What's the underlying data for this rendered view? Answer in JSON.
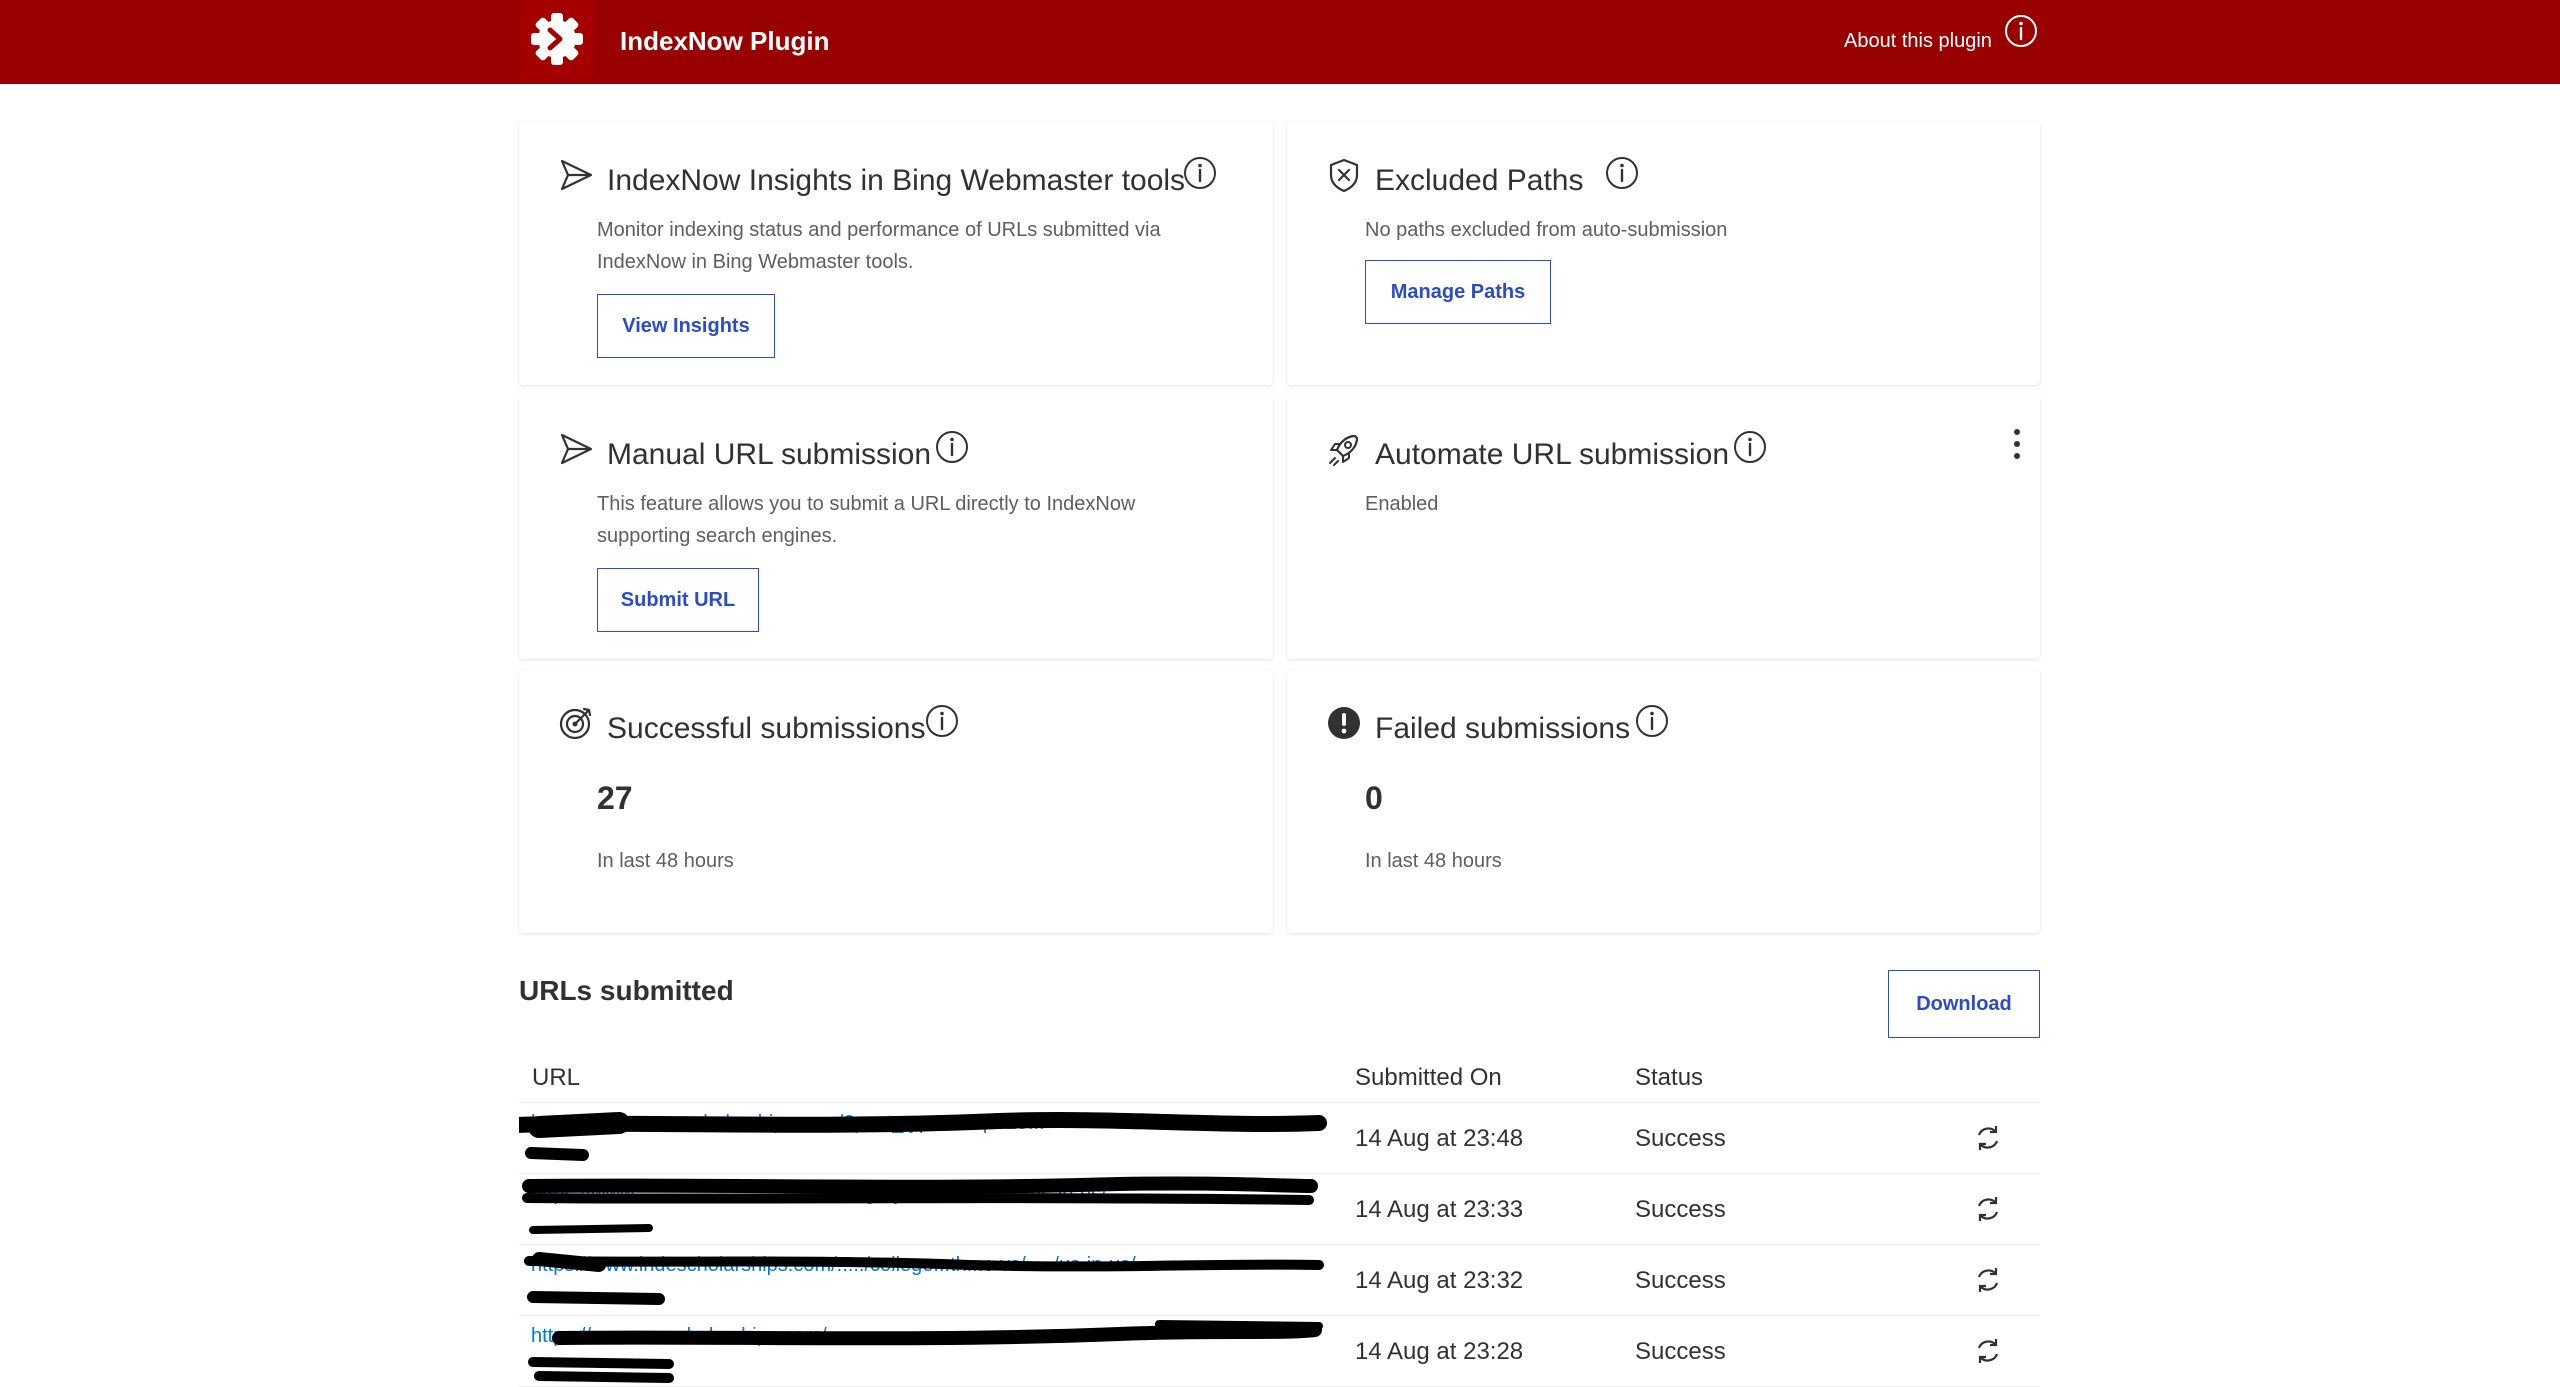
{
  "app": {
    "title": "IndexNow Plugin",
    "about_label": "About this plugin",
    "brand_color": "#990000"
  },
  "cards": {
    "insights": {
      "title": "IndexNow Insights in Bing Webmaster tools",
      "desc_line1": "Monitor indexing status and performance of URLs submitted via",
      "desc_line2": "IndexNow in Bing Webmaster tools.",
      "button": "View Insights"
    },
    "excluded": {
      "title": "Excluded Paths",
      "desc": "No paths excluded from auto-submission",
      "button": "Manage Paths"
    },
    "manual": {
      "title": "Manual URL submission",
      "desc_line1": "This feature allows you to submit a URL directly to IndexNow",
      "desc_line2": "supporting search engines.",
      "button": "Submit URL"
    },
    "automate": {
      "title": "Automate URL submission",
      "status": "Enabled"
    },
    "successful": {
      "title": "Successful submissions",
      "count": "27",
      "period": "In last 48 hours"
    },
    "failed": {
      "title": "Failed submissions",
      "count": "0",
      "period": "In last 48 hours"
    }
  },
  "urls_section": {
    "title": "URLs submitted",
    "download_label": "Download",
    "columns": {
      "url": "URL",
      "submitted_on": "Submitted On",
      "status": "Status"
    },
    "rows": [
      {
        "url": "https://www.........scholarships.com/?post_type=...&p=25...",
        "submitted_on": "14 Aug at 23:48",
        "status": "Success"
      },
      {
        "url": "https://www...........................com/category/........./.../ce.../us-in-us/",
        "submitted_on": "14 Aug at 23:33",
        "status": "Success"
      },
      {
        "url": "https://www.indescholarships.com/...../college...th...c-vs/...../us-in-us/",
        "submitted_on": "14 Aug at 23:32",
        "status": "Success"
      },
      {
        "url": "https://www......scholarships.com/........................",
        "submitted_on": "14 Aug at 23:28",
        "status": "Success"
      }
    ]
  }
}
